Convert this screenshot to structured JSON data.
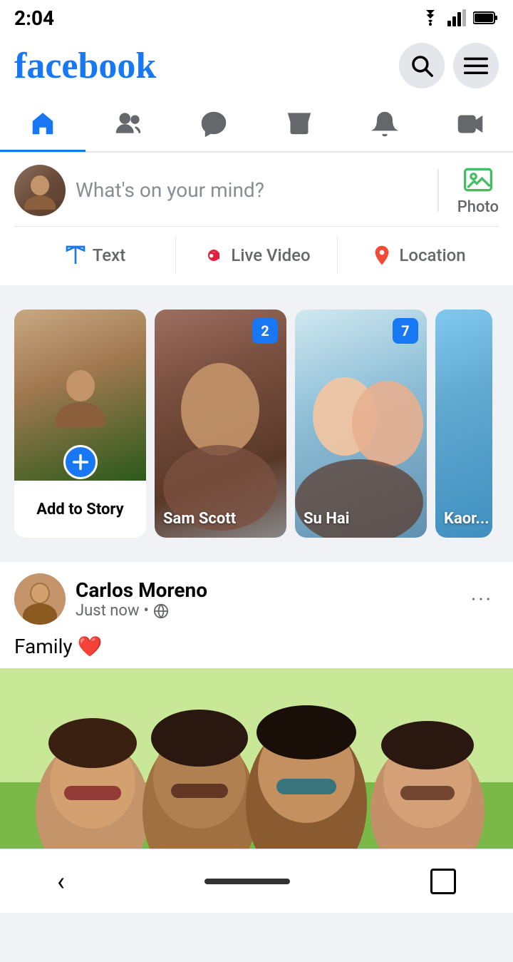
{
  "status": {
    "time": "2:04"
  },
  "header": {
    "logo": "facebook",
    "search_label": "search",
    "menu_label": "menu"
  },
  "nav": {
    "tabs": [
      {
        "id": "home",
        "label": "Home",
        "active": true
      },
      {
        "id": "friends",
        "label": "Friends",
        "active": false
      },
      {
        "id": "messenger",
        "label": "Messenger",
        "active": false
      },
      {
        "id": "marketplace",
        "label": "Marketplace",
        "active": false
      },
      {
        "id": "notifications",
        "label": "Notifications",
        "active": false
      },
      {
        "id": "video",
        "label": "Video",
        "active": false
      }
    ]
  },
  "post_creator": {
    "placeholder": "What's on your mind?",
    "photo_label": "Photo",
    "text_label": "Text",
    "live_video_label": "Live Video",
    "location_label": "Location"
  },
  "stories": [
    {
      "id": "self",
      "label": "Add to Story",
      "type": "self"
    },
    {
      "id": "sam",
      "name": "Sam Scott",
      "badge": "2",
      "type": "person"
    },
    {
      "id": "suhai",
      "name": "Su Hai",
      "badge": "7",
      "type": "person"
    },
    {
      "id": "kaori",
      "name": "Kaori Wata...",
      "badge": null,
      "type": "person"
    }
  ],
  "feed": {
    "posts": [
      {
        "id": "post1",
        "author": "Carlos Moreno",
        "timestamp": "Just now",
        "privacy": "public",
        "text": "Family ❤️",
        "has_image": true
      }
    ]
  },
  "bottom_nav": {
    "back_label": "‹",
    "square_label": "□"
  }
}
